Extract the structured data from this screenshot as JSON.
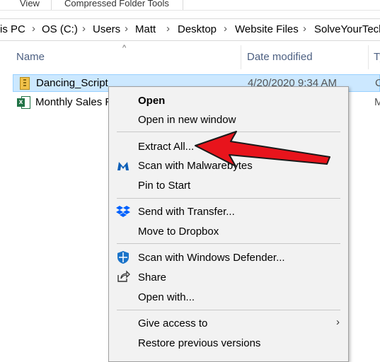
{
  "ribbon": {
    "tabs": [
      "View",
      "Compressed Folder Tools"
    ]
  },
  "address_bar": {
    "crumbs": [
      "is PC",
      "OS (C:)",
      "Users",
      "Matt",
      "Desktop",
      "Website Files",
      "SolveYourTech"
    ]
  },
  "columns": {
    "name": "Name",
    "date_modified": "Date modified",
    "type": "Ty"
  },
  "files": [
    {
      "name": "Dancing_Script",
      "date": "4/20/2020 9:34 AM",
      "type": "C",
      "icon": "zip-folder-icon",
      "selected": true
    },
    {
      "name": "Monthly Sales R",
      "type": "M",
      "icon": "excel-file-icon",
      "selected": false
    }
  ],
  "context_menu": {
    "groups": [
      {
        "items": [
          {
            "label": "Open",
            "bold": true
          },
          {
            "label": "Open in new window"
          }
        ]
      },
      {
        "items": [
          {
            "label": "Extract All..."
          },
          {
            "label": "Scan with Malwarebytes",
            "icon": "malwarebytes-icon"
          },
          {
            "label": "Pin to Start"
          }
        ]
      },
      {
        "items": [
          {
            "label": "Send with Transfer...",
            "icon": "dropbox-icon"
          },
          {
            "label": "Move to Dropbox"
          }
        ]
      },
      {
        "items": [
          {
            "label": "Scan with Windows Defender...",
            "icon": "windows-defender-icon"
          },
          {
            "label": "Share",
            "icon": "share-icon"
          },
          {
            "label": "Open with..."
          }
        ]
      },
      {
        "items": [
          {
            "label": "Give access to",
            "submenu": true
          },
          {
            "label": "Restore previous versions"
          }
        ]
      }
    ]
  },
  "annotation": {
    "arrow_color": "#e8141c",
    "points_to": "Extract All..."
  },
  "colors": {
    "selection": "#cce8ff",
    "header_text": "#4d6082",
    "menu_bg": "#f2f2f2",
    "malwarebytes": "#0d5fb8",
    "dropbox": "#0061fe",
    "defender": "#1a73c9"
  }
}
